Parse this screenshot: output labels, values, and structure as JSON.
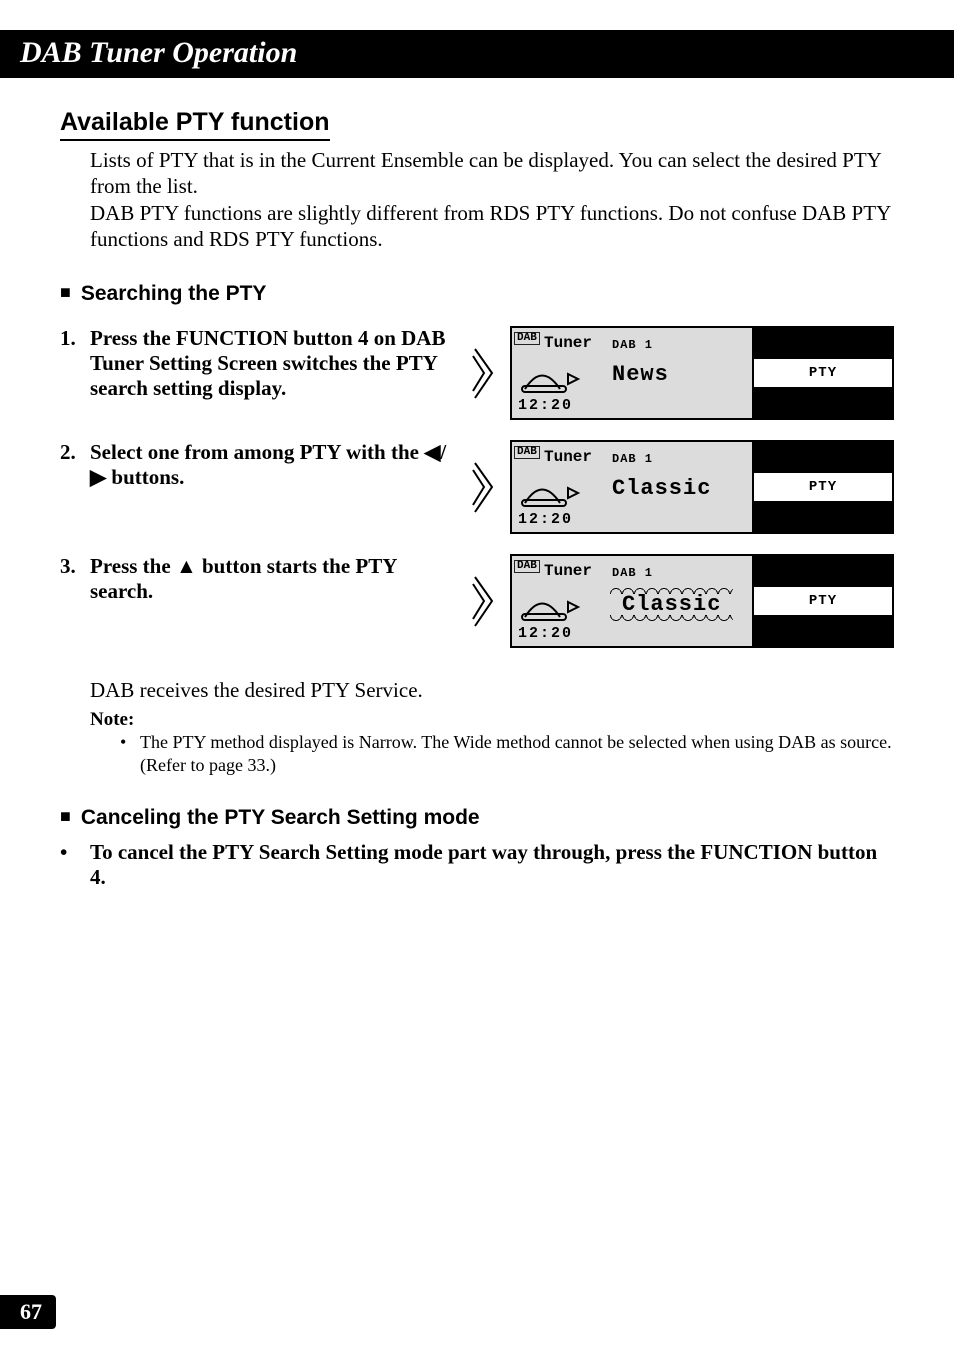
{
  "header": {
    "title": "DAB Tuner Operation"
  },
  "section": {
    "title": "Available PTY function",
    "intro_p1": "Lists of PTY that is in the Current Ensemble can be displayed. You can select the desired PTY from the list.",
    "intro_p2": "DAB PTY functions are slightly different from RDS PTY functions. Do not confuse DAB PTY functions and RDS PTY functions."
  },
  "sub1": {
    "title": "Searching the PTY",
    "steps": [
      {
        "num": "1.",
        "text": "Press the FUNCTION button 4 on DAB Tuner Setting Screen switches the PTY search setting display."
      },
      {
        "num": "2.",
        "text_pre": "Select one from among PTY with the ",
        "text_post": " buttons."
      },
      {
        "num": "3.",
        "text_pre": "Press the ",
        "text_post": " button starts the PTY search."
      }
    ],
    "receives": "DAB receives the desired PTY Service.",
    "note_label": "Note:",
    "note_text": "The PTY method displayed is Narrow. The Wide method cannot be selected when using DAB as source. (Refer to page 33.)"
  },
  "sub2": {
    "title": "Canceling the PTY Search Setting mode",
    "step": "To cancel the PTY Search Setting mode part way through, press the FUNCTION button 4."
  },
  "lcd_common": {
    "dab_badge": "DAB",
    "tuner_label": "Tuner",
    "band": "DAB 1",
    "time": "12:20",
    "pty": "PTY"
  },
  "lcd": [
    {
      "main": "News",
      "wavy": false
    },
    {
      "main": "Classic",
      "wavy": false
    },
    {
      "main": "Classic",
      "wavy": true
    }
  ],
  "page_number": "67"
}
